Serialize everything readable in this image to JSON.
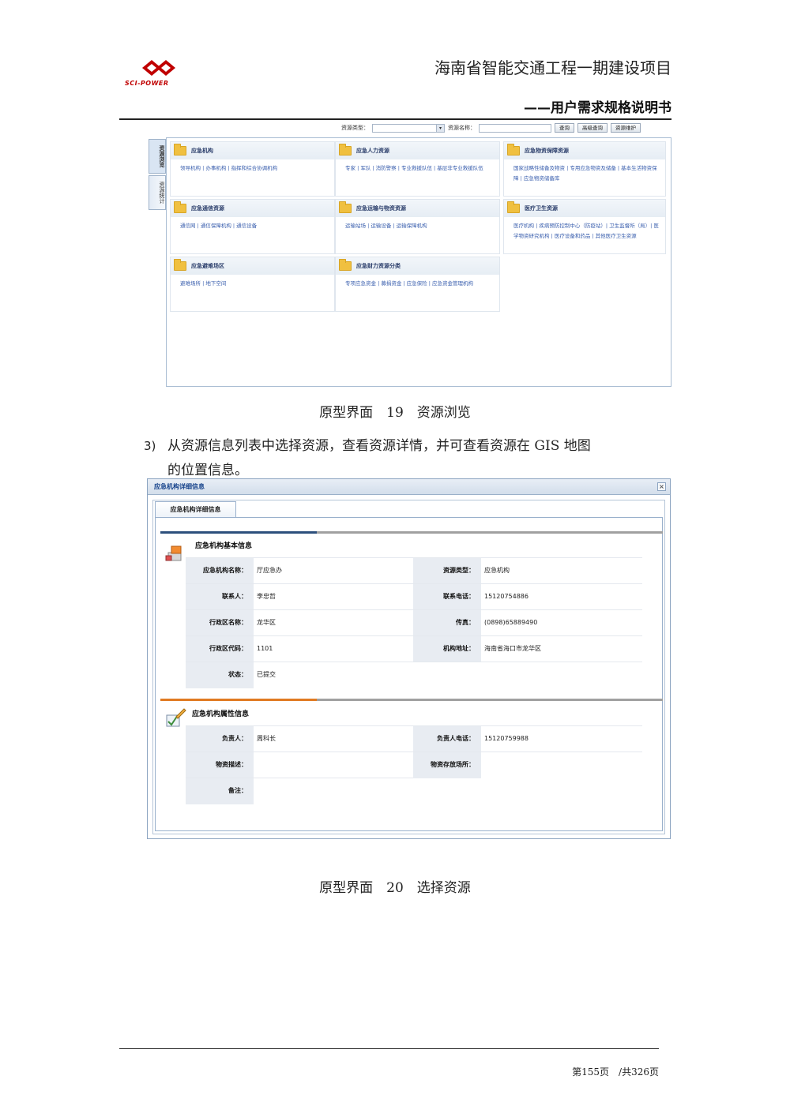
{
  "header": {
    "logo_text": "SCI-POWER",
    "title": "海南省智能交通工程一期建设项目",
    "subtitle": "——用户需求规格说明书"
  },
  "browse": {
    "toolbar": {
      "type_label": "资源类型：",
      "name_label": "资源名称：",
      "query_button": "查询",
      "advanced_query_button": "高级查询",
      "maintain_button": "资源维护"
    },
    "vtabs": [
      "资源浏览",
      "资源统计"
    ],
    "categories": [
      {
        "title": "应急机构",
        "links": "领导机构 | 办事机构 | 指挥和综合协调机构"
      },
      {
        "title": "应急人力资源",
        "links": "专家 | 军队 | 消防警察 | 专业救援队伍 | 基层非专业救援队伍"
      },
      {
        "title": "应急物资保障资源",
        "links": "国家战略性储备及物资 | 专用应急物资及储备 | 基本生活物资保障 | 应急物资储备库"
      },
      {
        "title": "应急通信资源",
        "links": "通信网 | 通信保障机构 | 通信设备"
      },
      {
        "title": "应急运输与物资资源",
        "links": "运输站场 | 运输设备 | 运输保障机构"
      },
      {
        "title": "医疗卫生资源",
        "links": "医疗机构 | 疾病预防控制中心（防疫站）| 卫生监督所（局）| 医学物资研究机构 | 医疗设备和药品 | 其他医疗卫生资源"
      },
      {
        "title": "应急避难场区",
        "links": "避难场所 | 地下空间"
      },
      {
        "title": "应急财力资源分类",
        "links": "专项应急资金 | 募捐资金 | 应急保险 | 应急资金管理机构"
      }
    ]
  },
  "caption1": "原型界面　19　资源浏览",
  "step": {
    "number": "3)",
    "line1": "从资源信息列表中选择资源，查看资源详情，并可查看资源在 GIS 地图",
    "line2": "的位置信息。"
  },
  "detail": {
    "window_title": "应急机构详细信息",
    "tab_label": "应急机构详细信息",
    "close_symbol": "×",
    "colors": {
      "basic_accent": "#2c4f7c",
      "attr_accent": "#e07a22"
    },
    "basic": {
      "title": "应急机构基本信息",
      "fields": {
        "name_label": "应急机构名称：",
        "name_value": "厅应急办",
        "type_label": "资源类型：",
        "type_value": "应急机构",
        "contact_label": "联系人：",
        "contact_value": "李忠哲",
        "phone_label": "联系电话：",
        "phone_value": "15120754886",
        "district_label": "行政区名称：",
        "district_value": "龙华区",
        "fax_label": "传真：",
        "fax_value": "(0898)65889490",
        "code_label": "行政区代码：",
        "code_value": "1101",
        "address_label": "机构地址：",
        "address_value": "海南省海口市龙华区",
        "status_label": "状态：",
        "status_value": "已提交"
      }
    },
    "attr": {
      "title": "应急机构属性信息",
      "fields": {
        "leader_label": "负责人：",
        "leader_value": "周科长",
        "leader_phone_label": "负责人电话：",
        "leader_phone_value": "15120759988",
        "desc_label": "物资描述：",
        "desc_value": "",
        "storage_label": "物资存放场所：",
        "storage_value": "",
        "remark_label": "备注：",
        "remark_value": ""
      }
    }
  },
  "caption2": "原型界面　20　选择资源",
  "footer": {
    "page": "第155页　/共326页"
  }
}
